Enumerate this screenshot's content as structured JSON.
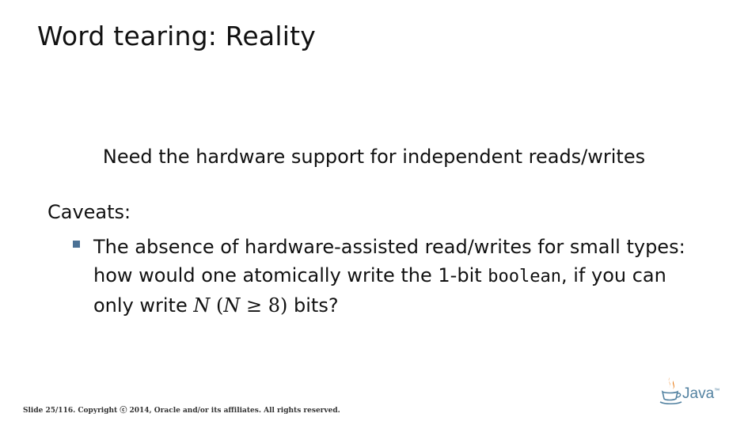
{
  "slide": {
    "title": "Word tearing: Reality",
    "lead": "Need the hardware support for independent reads/writes",
    "caveats_label": "Caveats:",
    "bullet": {
      "line1": "The absence of hardware-assisted read/writes for small types:",
      "line2_pre": "how would one atomically write the 1-bit ",
      "line2_code": "boolean",
      "line2_post": ", if you can",
      "line3_pre": "only write ",
      "line3_var": "N",
      "line3_open": " (",
      "line3_var2": "N",
      "line3_rel": " ≥ 8",
      "line3_close": ")",
      "line3_post": " bits?"
    }
  },
  "footer": {
    "slide_number": "Slide 25/116.",
    "copyright": "Copyright ⓒ 2014, Oracle and/or its affiliates. All rights reserved."
  },
  "logo": {
    "word": "Java",
    "tm": "™",
    "icon": "java-cup-icon",
    "colors": {
      "steam": "#e76f00",
      "cup": "#5382a1"
    }
  }
}
